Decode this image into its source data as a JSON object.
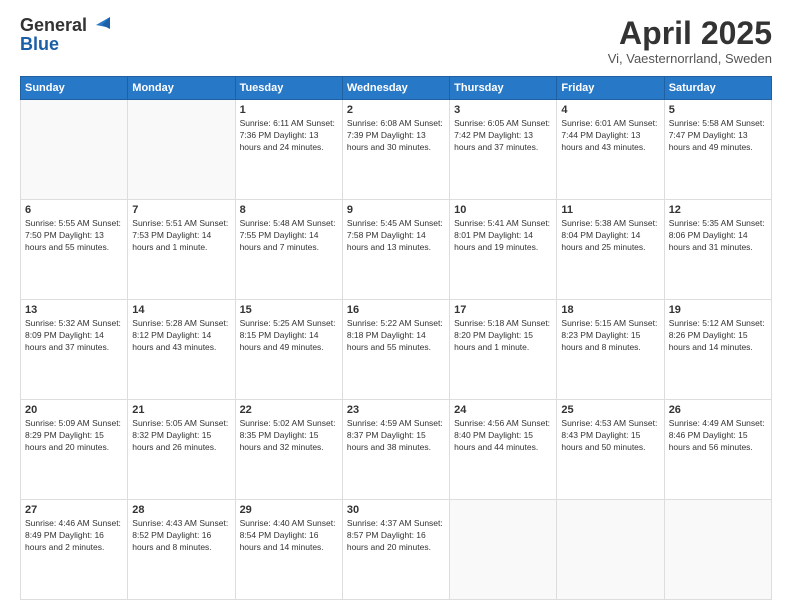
{
  "header": {
    "logo_general": "General",
    "logo_blue": "Blue",
    "month_title": "April 2025",
    "subtitle": "Vi, Vaesternorrland, Sweden"
  },
  "days_of_week": [
    "Sunday",
    "Monday",
    "Tuesday",
    "Wednesday",
    "Thursday",
    "Friday",
    "Saturday"
  ],
  "weeks": [
    [
      {
        "day": "",
        "info": ""
      },
      {
        "day": "",
        "info": ""
      },
      {
        "day": "1",
        "info": "Sunrise: 6:11 AM\nSunset: 7:36 PM\nDaylight: 13 hours\nand 24 minutes."
      },
      {
        "day": "2",
        "info": "Sunrise: 6:08 AM\nSunset: 7:39 PM\nDaylight: 13 hours\nand 30 minutes."
      },
      {
        "day": "3",
        "info": "Sunrise: 6:05 AM\nSunset: 7:42 PM\nDaylight: 13 hours\nand 37 minutes."
      },
      {
        "day": "4",
        "info": "Sunrise: 6:01 AM\nSunset: 7:44 PM\nDaylight: 13 hours\nand 43 minutes."
      },
      {
        "day": "5",
        "info": "Sunrise: 5:58 AM\nSunset: 7:47 PM\nDaylight: 13 hours\nand 49 minutes."
      }
    ],
    [
      {
        "day": "6",
        "info": "Sunrise: 5:55 AM\nSunset: 7:50 PM\nDaylight: 13 hours\nand 55 minutes."
      },
      {
        "day": "7",
        "info": "Sunrise: 5:51 AM\nSunset: 7:53 PM\nDaylight: 14 hours\nand 1 minute."
      },
      {
        "day": "8",
        "info": "Sunrise: 5:48 AM\nSunset: 7:55 PM\nDaylight: 14 hours\nand 7 minutes."
      },
      {
        "day": "9",
        "info": "Sunrise: 5:45 AM\nSunset: 7:58 PM\nDaylight: 14 hours\nand 13 minutes."
      },
      {
        "day": "10",
        "info": "Sunrise: 5:41 AM\nSunset: 8:01 PM\nDaylight: 14 hours\nand 19 minutes."
      },
      {
        "day": "11",
        "info": "Sunrise: 5:38 AM\nSunset: 8:04 PM\nDaylight: 14 hours\nand 25 minutes."
      },
      {
        "day": "12",
        "info": "Sunrise: 5:35 AM\nSunset: 8:06 PM\nDaylight: 14 hours\nand 31 minutes."
      }
    ],
    [
      {
        "day": "13",
        "info": "Sunrise: 5:32 AM\nSunset: 8:09 PM\nDaylight: 14 hours\nand 37 minutes."
      },
      {
        "day": "14",
        "info": "Sunrise: 5:28 AM\nSunset: 8:12 PM\nDaylight: 14 hours\nand 43 minutes."
      },
      {
        "day": "15",
        "info": "Sunrise: 5:25 AM\nSunset: 8:15 PM\nDaylight: 14 hours\nand 49 minutes."
      },
      {
        "day": "16",
        "info": "Sunrise: 5:22 AM\nSunset: 8:18 PM\nDaylight: 14 hours\nand 55 minutes."
      },
      {
        "day": "17",
        "info": "Sunrise: 5:18 AM\nSunset: 8:20 PM\nDaylight: 15 hours\nand 1 minute."
      },
      {
        "day": "18",
        "info": "Sunrise: 5:15 AM\nSunset: 8:23 PM\nDaylight: 15 hours\nand 8 minutes."
      },
      {
        "day": "19",
        "info": "Sunrise: 5:12 AM\nSunset: 8:26 PM\nDaylight: 15 hours\nand 14 minutes."
      }
    ],
    [
      {
        "day": "20",
        "info": "Sunrise: 5:09 AM\nSunset: 8:29 PM\nDaylight: 15 hours\nand 20 minutes."
      },
      {
        "day": "21",
        "info": "Sunrise: 5:05 AM\nSunset: 8:32 PM\nDaylight: 15 hours\nand 26 minutes."
      },
      {
        "day": "22",
        "info": "Sunrise: 5:02 AM\nSunset: 8:35 PM\nDaylight: 15 hours\nand 32 minutes."
      },
      {
        "day": "23",
        "info": "Sunrise: 4:59 AM\nSunset: 8:37 PM\nDaylight: 15 hours\nand 38 minutes."
      },
      {
        "day": "24",
        "info": "Sunrise: 4:56 AM\nSunset: 8:40 PM\nDaylight: 15 hours\nand 44 minutes."
      },
      {
        "day": "25",
        "info": "Sunrise: 4:53 AM\nSunset: 8:43 PM\nDaylight: 15 hours\nand 50 minutes."
      },
      {
        "day": "26",
        "info": "Sunrise: 4:49 AM\nSunset: 8:46 PM\nDaylight: 15 hours\nand 56 minutes."
      }
    ],
    [
      {
        "day": "27",
        "info": "Sunrise: 4:46 AM\nSunset: 8:49 PM\nDaylight: 16 hours\nand 2 minutes."
      },
      {
        "day": "28",
        "info": "Sunrise: 4:43 AM\nSunset: 8:52 PM\nDaylight: 16 hours\nand 8 minutes."
      },
      {
        "day": "29",
        "info": "Sunrise: 4:40 AM\nSunset: 8:54 PM\nDaylight: 16 hours\nand 14 minutes."
      },
      {
        "day": "30",
        "info": "Sunrise: 4:37 AM\nSunset: 8:57 PM\nDaylight: 16 hours\nand 20 minutes."
      },
      {
        "day": "",
        "info": ""
      },
      {
        "day": "",
        "info": ""
      },
      {
        "day": "",
        "info": ""
      }
    ]
  ]
}
